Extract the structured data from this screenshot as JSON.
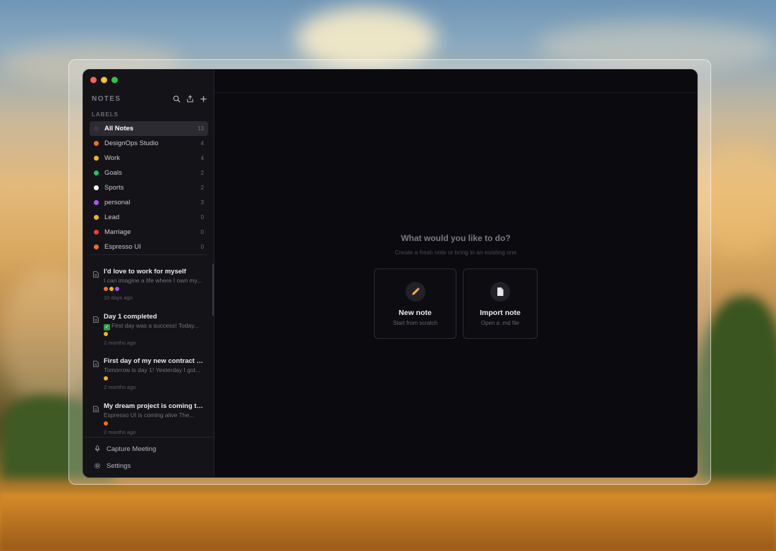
{
  "window": {
    "controls": [
      "close",
      "minimize",
      "maximize"
    ]
  },
  "sidebar": {
    "title": "NOTES",
    "header_icons": [
      "search-icon",
      "export-icon",
      "plus-icon"
    ],
    "labels_heading": "LABELS",
    "labels": [
      {
        "name": "All Notes",
        "count": "13",
        "color": "#3a393f",
        "active": true
      },
      {
        "name": "DesignOps Studio",
        "count": "4",
        "color": "#f2711c"
      },
      {
        "name": "Work",
        "count": "4",
        "color": "#f5b324"
      },
      {
        "name": "Goals",
        "count": "2",
        "color": "#22c55e"
      },
      {
        "name": "Sports",
        "count": "2",
        "color": "#ffffff"
      },
      {
        "name": "personal",
        "count": "3",
        "color": "#a855f7"
      },
      {
        "name": "Lead",
        "count": "0",
        "color": "#f5b324"
      },
      {
        "name": "Marriage",
        "count": "0",
        "color": "#ef3b32"
      },
      {
        "name": "Espresso UI",
        "count": "0",
        "color": "#f2711c"
      }
    ],
    "notes": [
      {
        "title": "I'd love to work for myself",
        "preview": "I can imagine a life where I own my...",
        "tags": [
          "#f2711c",
          "#f5b324",
          "#a855f7"
        ],
        "time": "10 days ago"
      },
      {
        "title": "Day 1 completed",
        "preview": "First day was a success! Today...",
        "preview_emoji": "✓",
        "tags": [
          "#f5b324"
        ],
        "time": "2 months ago"
      },
      {
        "title": "First day of my new contract wi...",
        "preview": "Tomorrow is day 1! Yesterday I got...",
        "tags": [
          "#f5b324"
        ],
        "time": "2 months ago"
      },
      {
        "title": "My dream project is coming to l...",
        "preview": "Espresso UI is coming alive The...",
        "tags": [
          "#f2711c"
        ],
        "time": "2 months ago"
      }
    ],
    "bottom": {
      "capture": "Capture Meeting",
      "settings": "Settings"
    }
  },
  "main": {
    "empty_title": "What would you like to do?",
    "empty_subtitle": "Create a fresh note or bring in an existing one",
    "cards": {
      "new": {
        "title": "New note",
        "subtitle": "Start from scratch",
        "icon": "pencil-icon"
      },
      "import": {
        "title": "Import note",
        "subtitle": "Open a .md file",
        "icon": "document-icon"
      }
    }
  }
}
